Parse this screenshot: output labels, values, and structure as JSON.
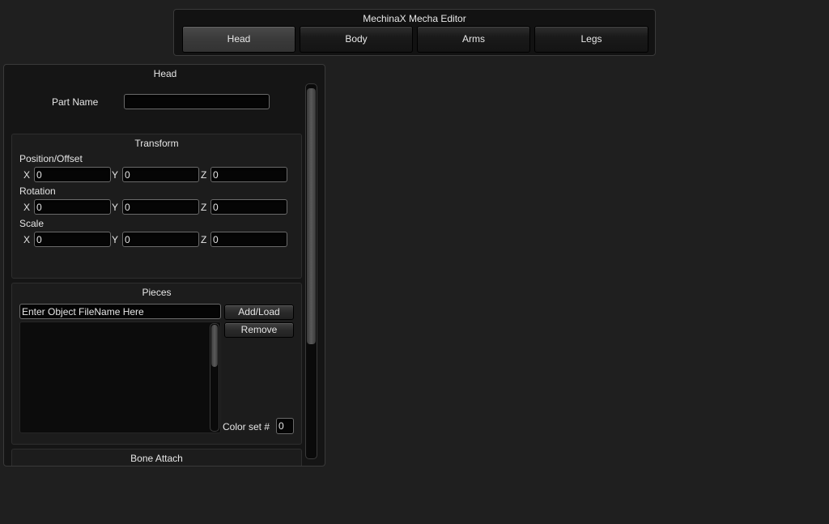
{
  "app": {
    "title": "MechinaX Mecha Editor",
    "tabs": [
      {
        "label": "Head",
        "active": true
      },
      {
        "label": "Body",
        "active": false
      },
      {
        "label": "Arms",
        "active": false
      },
      {
        "label": "Legs",
        "active": false
      }
    ]
  },
  "panel": {
    "title": "Head",
    "part_name_label": "Part Name",
    "part_name_value": "",
    "transform": {
      "title": "Transform",
      "position": {
        "label": "Position/Offset",
        "x": "0",
        "y": "0",
        "z": "0"
      },
      "rotation": {
        "label": "Rotation",
        "x": "0",
        "y": "0",
        "z": "0"
      },
      "scale": {
        "label": "Scale",
        "x": "0",
        "y": "0",
        "z": "0"
      },
      "axis_labels": {
        "x": "X",
        "y": "Y",
        "z": "Z"
      }
    },
    "pieces": {
      "title": "Pieces",
      "filename_value": "Enter Object FileName Here",
      "add_load_label": "Add/Load",
      "remove_label": "Remove",
      "color_set_label": "Color set #",
      "color_set_value": "0",
      "items": []
    },
    "bone_attach": {
      "title": "Bone Attach"
    }
  },
  "colors": {
    "background": "#1f1f1f",
    "panel": "#151515",
    "active_tab": "#3a3a3a"
  }
}
